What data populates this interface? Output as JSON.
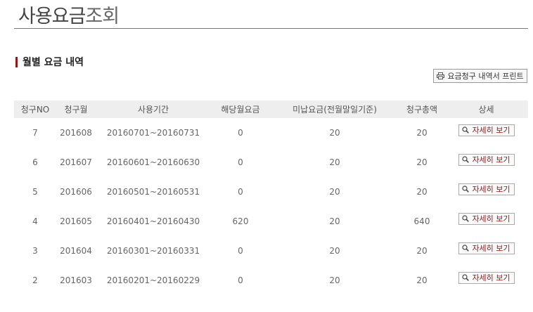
{
  "header": {
    "title_part1": "사용요금",
    "title_part2": "조회"
  },
  "section": {
    "heading": "월별 요금 내역"
  },
  "toolbar": {
    "print_label": "요금청구 내역서 프린트"
  },
  "table": {
    "columns": [
      "청구NO",
      "청구월",
      "사용기간",
      "해당월요금",
      "미납요금(전월말일기준)",
      "청구총액",
      "상세"
    ],
    "detail_label": "자세히 보기",
    "rows": [
      {
        "no": "7",
        "month": "201608",
        "period": "20160701~20160731",
        "current": "0",
        "unpaid": "20",
        "total": "20"
      },
      {
        "no": "6",
        "month": "201607",
        "period": "20160601~20160630",
        "current": "0",
        "unpaid": "20",
        "total": "20"
      },
      {
        "no": "5",
        "month": "201606",
        "period": "20160501~20160531",
        "current": "0",
        "unpaid": "20",
        "total": "20"
      },
      {
        "no": "4",
        "month": "201605",
        "period": "20160401~20160430",
        "current": "620",
        "unpaid": "20",
        "total": "640"
      },
      {
        "no": "3",
        "month": "201604",
        "period": "20160301~20160331",
        "current": "0",
        "unpaid": "20",
        "total": "20"
      },
      {
        "no": "2",
        "month": "201603",
        "period": "20160201~20160229",
        "current": "0",
        "unpaid": "20",
        "total": "20"
      }
    ]
  },
  "icons": {
    "print": "printer-icon",
    "detail": "magnifier-icon"
  },
  "colors": {
    "accent": "#8b1a1a",
    "header_bg": "#eeeeee",
    "rule": "#777777"
  }
}
